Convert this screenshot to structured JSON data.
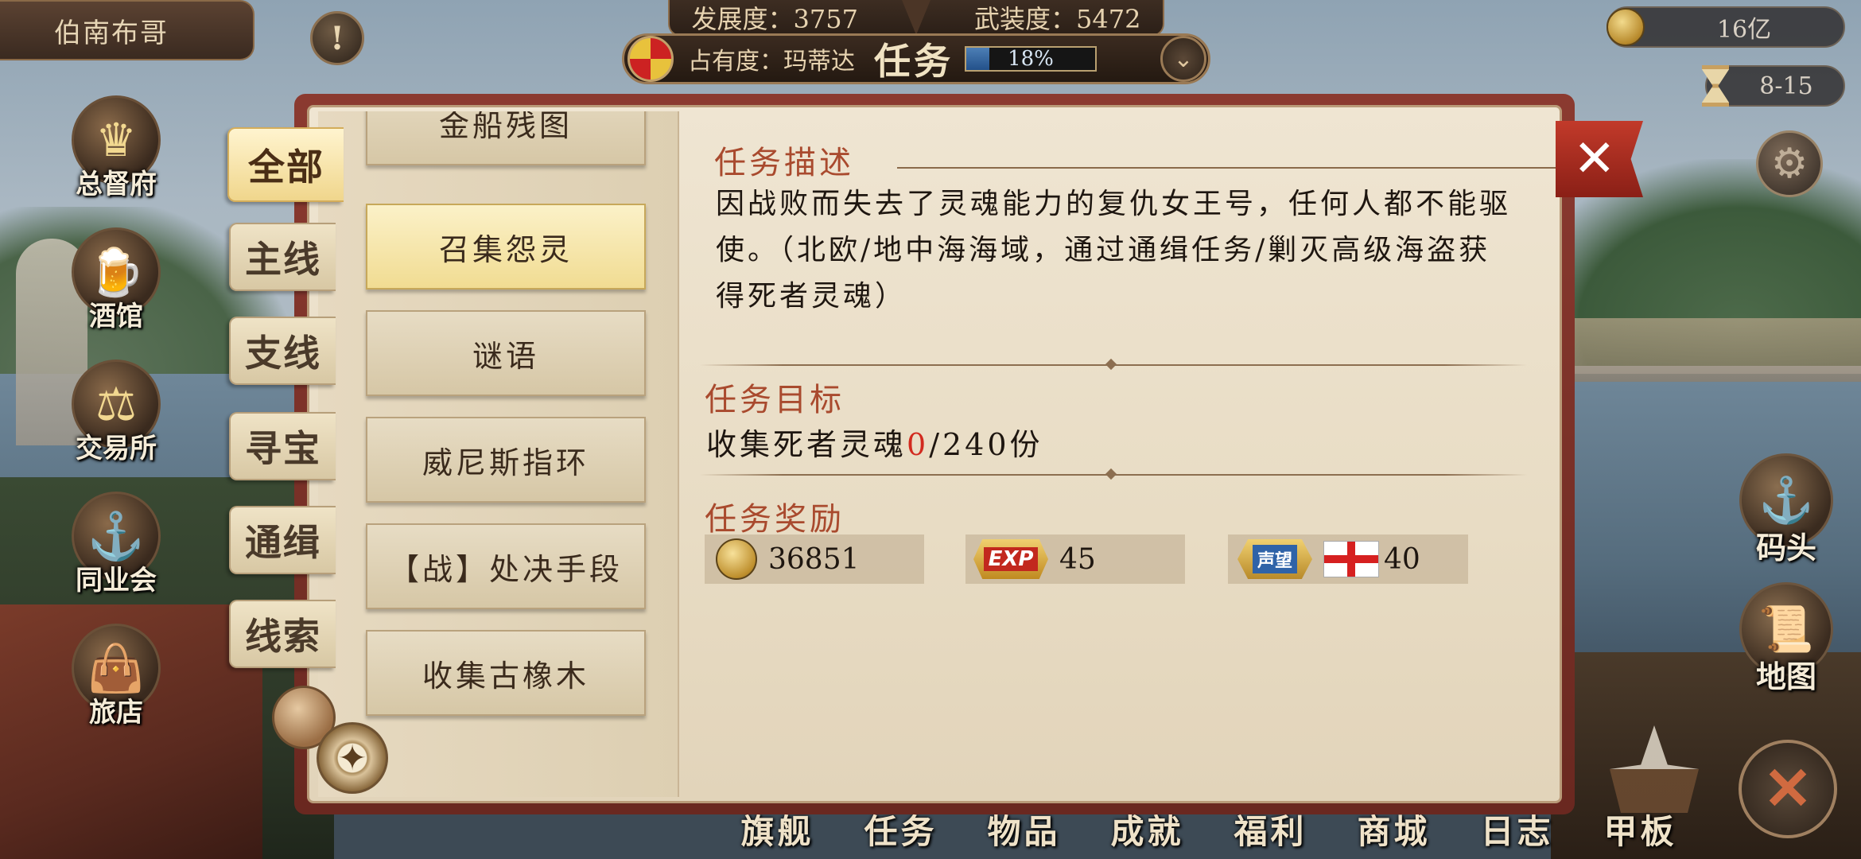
{
  "player": {
    "name": "伯南布哥"
  },
  "hud": {
    "development": "发展度：3757",
    "armament": "武装度：5472",
    "occupancy": "占有度：玛蒂达",
    "title": "任务",
    "progress_text": "18%",
    "progress_value": 0.18,
    "gold": "16亿",
    "date": "8-15",
    "alert_icon": "!"
  },
  "left_menu": [
    {
      "label": "总督府",
      "icon": "crown-icon",
      "glyph": "♛"
    },
    {
      "label": "酒馆",
      "icon": "beer-mug-icon",
      "glyph": "🍺"
    },
    {
      "label": "交易所",
      "icon": "scales-icon",
      "glyph": "⚖"
    },
    {
      "label": "同业会",
      "icon": "anchor-shield-icon",
      "glyph": "⚓"
    },
    {
      "label": "旅店",
      "icon": "bag-icon",
      "glyph": "👜"
    }
  ],
  "right_menu": [
    {
      "label": "码头",
      "icon": "dock-icon",
      "glyph": "⚓"
    },
    {
      "label": "地图",
      "icon": "scroll-map-icon",
      "glyph": "📜"
    }
  ],
  "bottom_nav": [
    "旗舰",
    "任务",
    "物品",
    "成就",
    "福利",
    "商城",
    "日志",
    "甲板"
  ],
  "tabs": [
    "全部",
    "主线",
    "支线",
    "寻宝",
    "通缉",
    "线索"
  ],
  "quest_list": {
    "partial_top": "金船残图",
    "items": [
      "召集怨灵",
      "谜语",
      "威尼斯指环",
      "【战】处决手段",
      "收集古橡木"
    ],
    "selected_index": 0
  },
  "detail": {
    "desc_title": "任务描述",
    "description": "因战败而失去了灵魂能力的复仇女王号，任何人都不能驱使。（北欧/地中海海域，通过通缉任务/剿灭高级海盗获得死者灵魂）",
    "target_title": "任务目标",
    "target_prefix": "收集死者灵魂",
    "target_current": "0",
    "target_suffix": "/240份",
    "reward_title": "任务奖励",
    "rewards": {
      "gold": "36851",
      "exp_label": "EXP",
      "exp": "45",
      "rep_label": "声望",
      "reputation": "40"
    }
  },
  "colors": {
    "accent_red": "#d22a1e",
    "section_title": "#a94a2e",
    "panel_bg": "#efe5d2"
  }
}
